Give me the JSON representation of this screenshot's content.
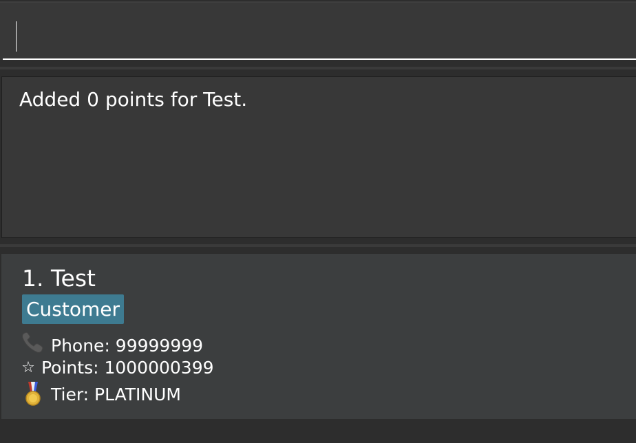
{
  "command_box": {
    "value": ""
  },
  "result_display": {
    "message": "Added 0 points for Test."
  },
  "person_list": {
    "persons": [
      {
        "index_name": "1. Test",
        "tag": "Customer",
        "phone": "Phone: 99999999",
        "points": "Points: 1000000399",
        "tier": "Tier: PLATINUM",
        "icons": {
          "phone": "phone-icon",
          "points": "star-icon",
          "tier": "medal-icon"
        }
      }
    ]
  },
  "colors": {
    "background": "#2d2d2d",
    "panel": "#383838",
    "card": "#3c3e3f",
    "tag": "#3e7b91",
    "text": "#ffffff"
  }
}
